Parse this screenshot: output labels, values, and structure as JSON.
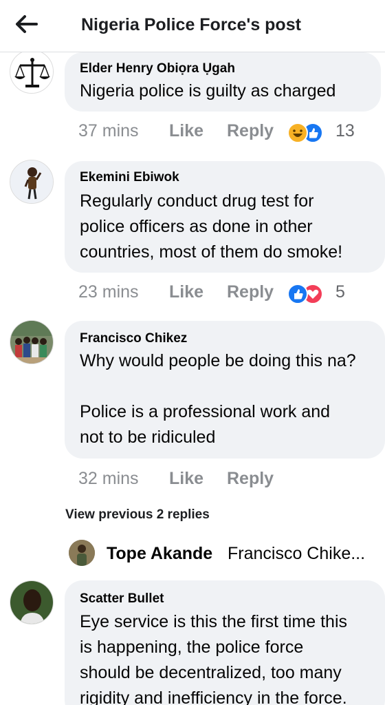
{
  "header": {
    "title": "Nigeria Police Force's post"
  },
  "comments": [
    {
      "author": "Elder Henry Obiọra Ụgah",
      "text": "Nigeria police is guilty as charged",
      "time": "37 mins",
      "like": "Like",
      "reply": "Reply",
      "reactions": [
        "haha-icon",
        "like-icon"
      ],
      "reaction_count": "13"
    },
    {
      "author": "Ekemini Ebiwok",
      "text": "Regularly conduct drug test for\npolice officers as done in other\ncountries, most of them do smoke!",
      "time": "23 mins",
      "like": "Like",
      "reply": "Reply",
      "reactions": [
        "like-icon",
        "love-icon"
      ],
      "reaction_count": "5"
    },
    {
      "author": "Francisco Chikez",
      "text": "Why would people be doing this na?\n\nPolice  is a professional work and\nnot to be ridiculed",
      "time": "32 mins",
      "like": "Like",
      "reply": "Reply"
    },
    {
      "author": "Scatter Bullet",
      "text": "Eye service is this the first time this\nis happening, the police force\nshould be decentralized, too many\nrigidity and inefficiency in the force."
    }
  ],
  "replies": {
    "view_previous": "View previous 2 replies",
    "latest_author": "Tope Akande",
    "latest_preview": "Francisco Chike..."
  },
  "colors": {
    "bubble": "#f0f2f5",
    "like_blue": "#1877f2",
    "love_red": "#f33e58",
    "haha_yellow": "#f7b125",
    "meta_gray": "#8a8d91"
  }
}
